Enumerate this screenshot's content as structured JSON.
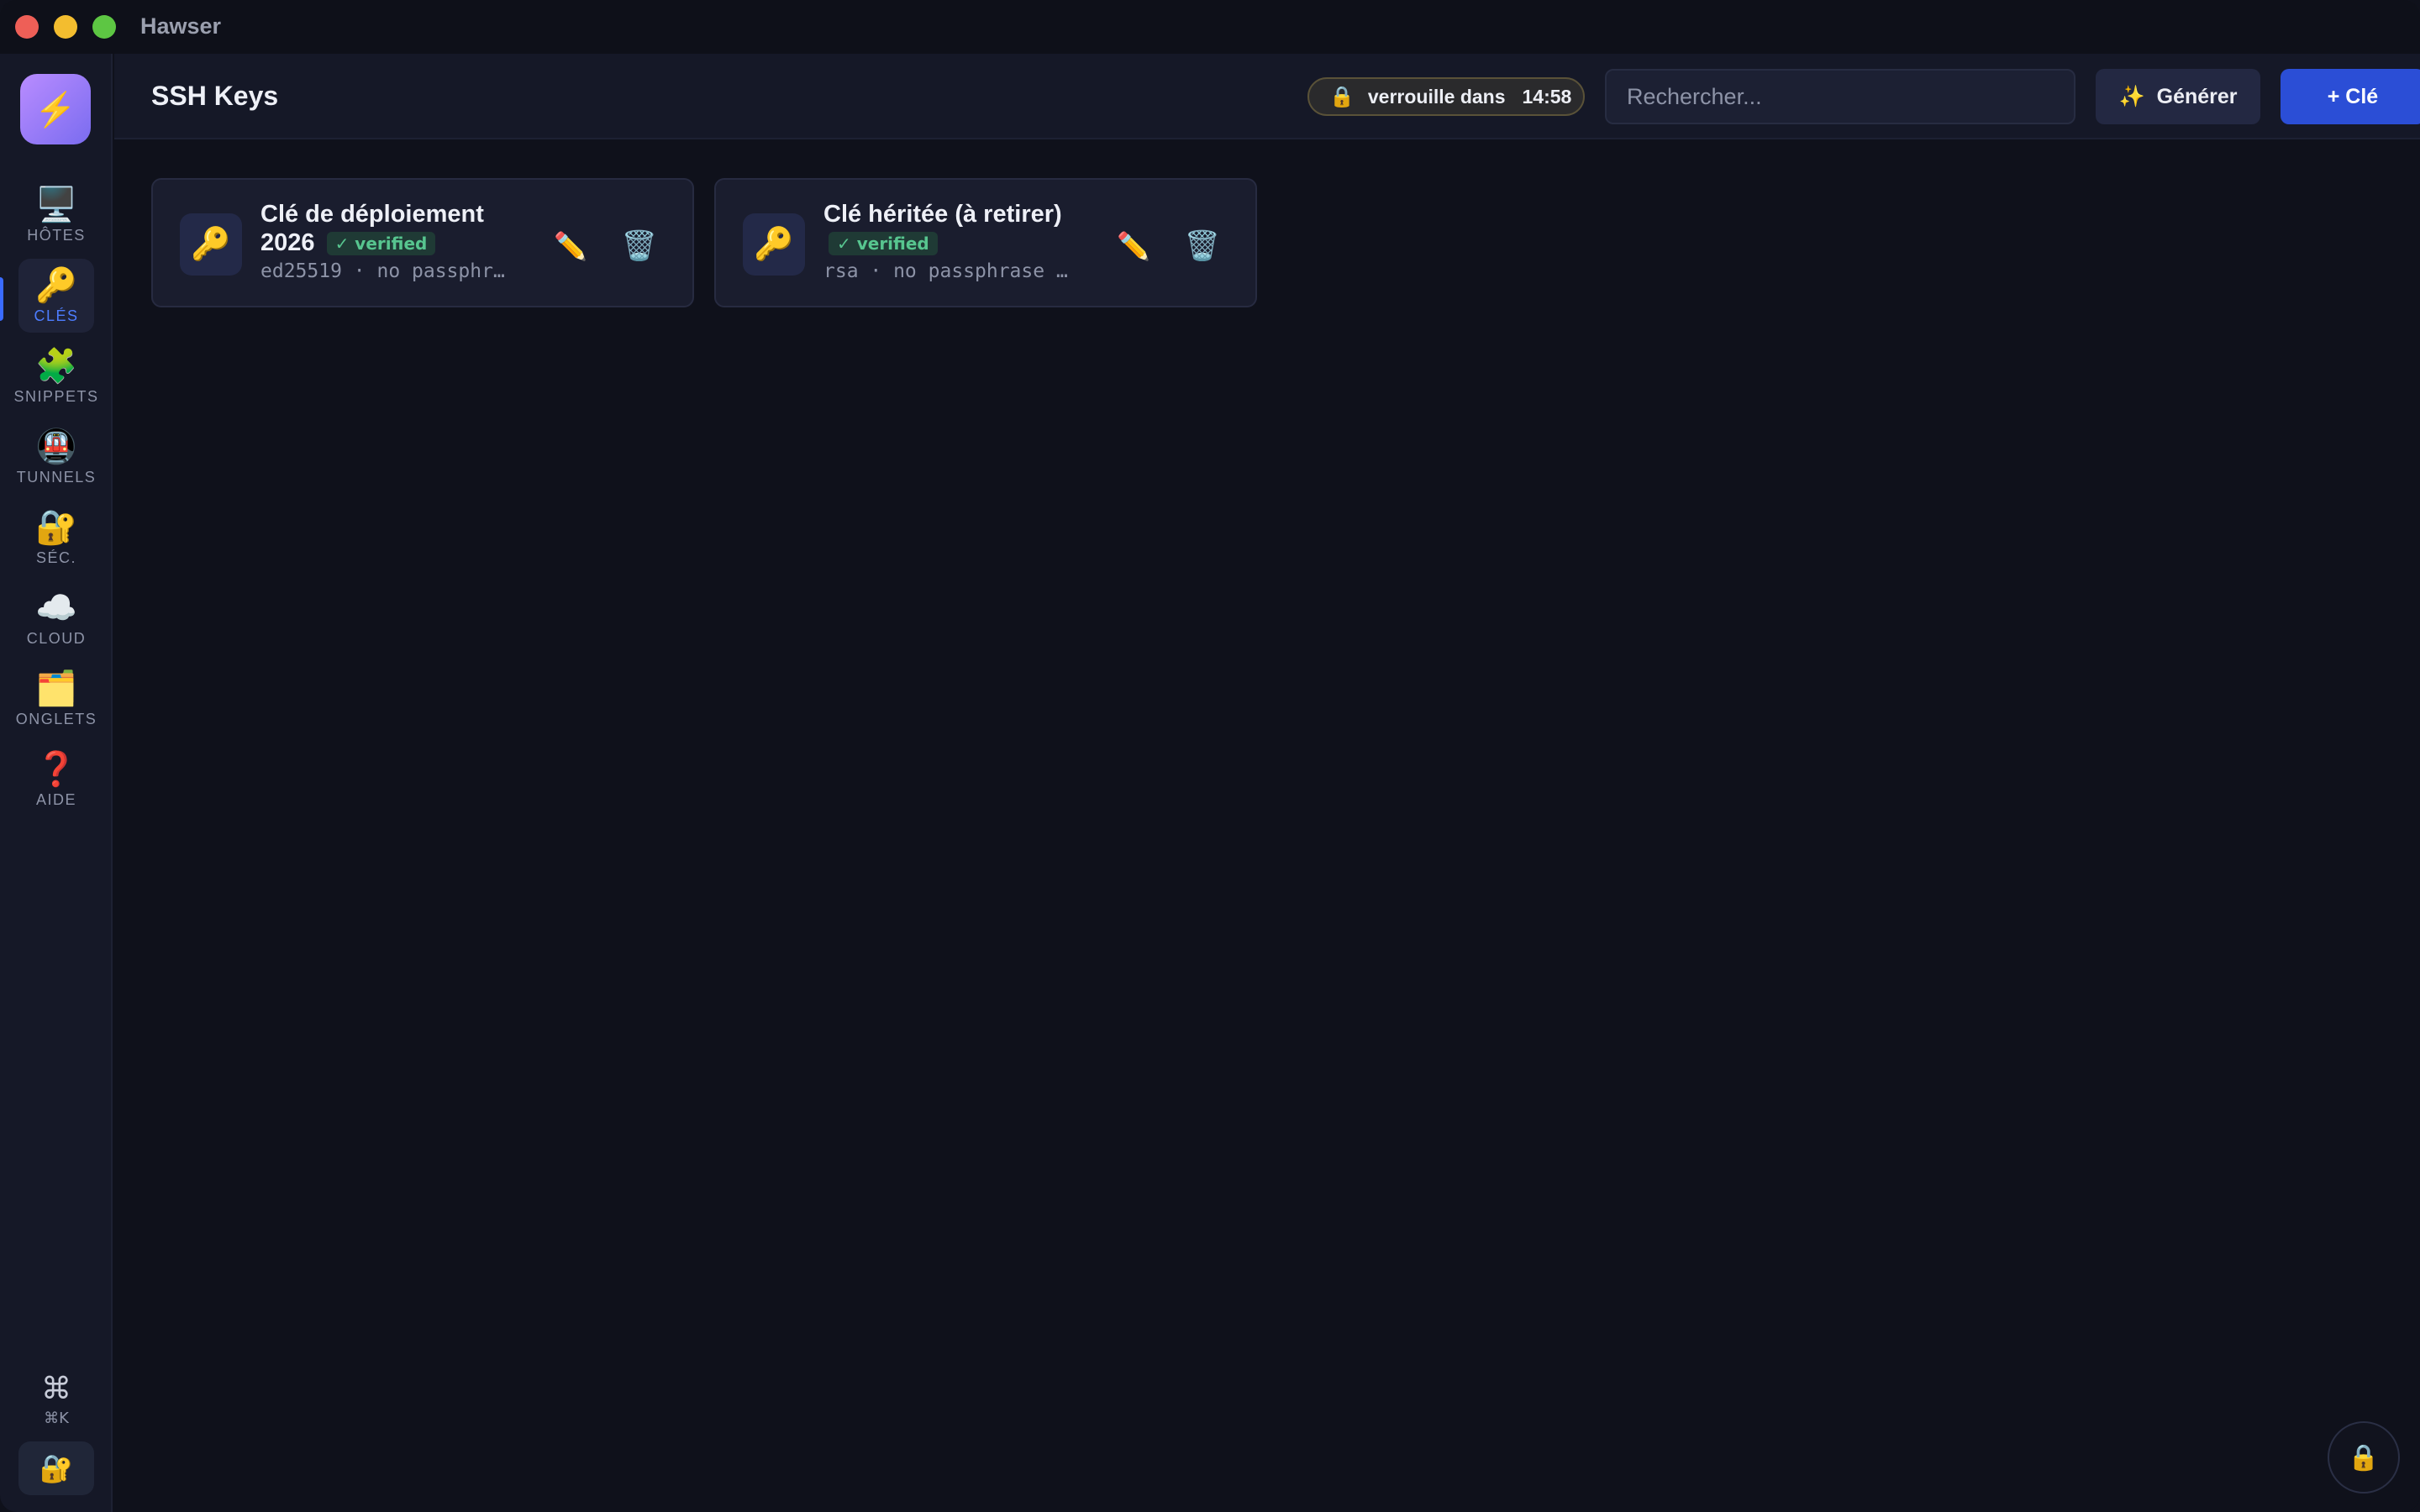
{
  "window": {
    "app_title": "Hawser"
  },
  "sidebar": {
    "logo_icon": "⚡",
    "items": [
      {
        "icon": "🖥️",
        "label": "HÔTES",
        "active": false
      },
      {
        "icon": "🔑",
        "label": "CLÉS",
        "active": true
      },
      {
        "icon": "🧩",
        "label": "SNIPPETS",
        "active": false
      },
      {
        "icon": "🚇",
        "label": "TUNNELS",
        "active": false
      },
      {
        "icon": "🔐",
        "label": "SÉC.",
        "active": false
      },
      {
        "icon": "☁️",
        "label": "CLOUD",
        "active": false
      },
      {
        "icon": "🗂️",
        "label": "ONGLETS",
        "active": false
      },
      {
        "icon": "❓",
        "label": "AIDE",
        "active": false
      }
    ],
    "cmdk_icon": "⌘",
    "cmdk_label": "⌘K",
    "lock_icon": "🔐"
  },
  "header": {
    "title": "SSH Keys",
    "lock_badge_icon": "🔒",
    "lock_badge_text": "verrouille dans",
    "lock_badge_time": "14:58",
    "search_placeholder": "Rechercher...",
    "generate_icon": "✨",
    "generate_label": "Générer",
    "add_key_label": "+ Clé"
  },
  "keys": [
    {
      "icon": "🔑",
      "title": "Clé de déploiement 2026",
      "badge": "✓ verified",
      "subtitle": "ed25519 · no passphr…",
      "edit_icon": "✏️",
      "delete_icon": "🗑️"
    },
    {
      "icon": "🔑",
      "title": "Clé héritée (à retirer)",
      "badge": "✓ verified",
      "subtitle": "rsa · no passphrase …",
      "edit_icon": "✏️",
      "delete_icon": "🗑️"
    }
  ],
  "fab_lock_icon": "🔒",
  "colors": {
    "background": "#0f111b",
    "sidebar": "#151827",
    "accent": "#2b4ed6",
    "verified": "#57c58f"
  }
}
